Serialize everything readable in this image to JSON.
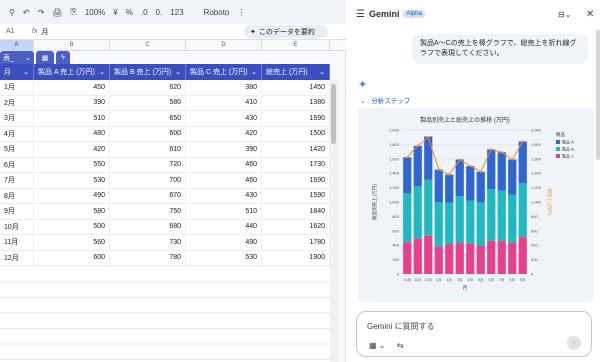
{
  "toolbar": {
    "items": [
      "↶",
      "↷",
      "🖨",
      "⎘",
      "100%",
      "¥",
      "%",
      ".0",
      "0.",
      "123",
      "Roboto",
      "⋮"
    ],
    "summarize_label": "このデータを要約"
  },
  "formula_bar": {
    "cell_ref": "A1",
    "fx": "fx",
    "value": "月"
  },
  "column_letters": [
    "A",
    "B",
    "C",
    "D",
    "E"
  ],
  "table": {
    "name": "表_",
    "headers": [
      "月",
      "製品 A 売上 (万円)",
      "製品 B 売上 (万円)",
      "製品 C 売上 (万円)",
      "総売上 (万円)"
    ],
    "rows": [
      [
        "1月",
        "450",
        "620",
        "380",
        "1450"
      ],
      [
        "2月",
        "390",
        "580",
        "410",
        "1380"
      ],
      [
        "3月",
        "510",
        "650",
        "430",
        "1590"
      ],
      [
        "4月",
        "480",
        "600",
        "420",
        "1500"
      ],
      [
        "5月",
        "420",
        "610",
        "390",
        "1420"
      ],
      [
        "6月",
        "550",
        "720",
        "460",
        "1730"
      ],
      [
        "7月",
        "530",
        "700",
        "460",
        "1690"
      ],
      [
        "8月",
        "490",
        "670",
        "430",
        "1590"
      ],
      [
        "9月",
        "580",
        "750",
        "510",
        "1840"
      ],
      [
        "10月",
        "500",
        "680",
        "440",
        "1620"
      ],
      [
        "11月",
        "560",
        "730",
        "490",
        "1780"
      ],
      [
        "12月",
        "600",
        "780",
        "530",
        "1900"
      ]
    ]
  },
  "gemini": {
    "title": "Gemini",
    "badge": "Alpha",
    "user_message": "製品A〜Cの売上を棒グラフで、総売上を折れ線グラフで表現してください。",
    "steps_label": "分析ステップ",
    "input_placeholder": "Gemini に質問する"
  },
  "chart_data": {
    "type": "bar",
    "title": "製品別売上と総売上の推移 (万円)",
    "xlabel": "月",
    "ylabel": "製品別売上 (万円)",
    "y2label": "総売上 (万円)",
    "categories": [
      "10月",
      "11月",
      "12月",
      "1月",
      "2月",
      "3月",
      "4月",
      "5月",
      "6月",
      "7月",
      "8月",
      "9月"
    ],
    "stacked": true,
    "ylim": [
      0,
      2000
    ],
    "yticks": [
      "0",
      "200",
      "400",
      "600",
      "800",
      "1,000",
      "1,200",
      "1,400",
      "1,600",
      "1,800",
      "2,000"
    ],
    "series": [
      {
        "name": "製品 C",
        "color": "#e8418c",
        "values": [
          440,
          490,
          530,
          380,
          410,
          430,
          420,
          390,
          460,
          460,
          430,
          510
        ]
      },
      {
        "name": "製品 B",
        "color": "#22b8c2",
        "values": [
          680,
          730,
          780,
          620,
          580,
          650,
          600,
          610,
          720,
          700,
          670,
          750
        ]
      },
      {
        "name": "製品 A",
        "color": "#2f66d0",
        "values": [
          500,
          560,
          600,
          450,
          390,
          510,
          480,
          420,
          550,
          530,
          490,
          580
        ]
      }
    ],
    "line": {
      "color": "#f28c28",
      "values": [
        1620,
        1780,
        1900,
        1450,
        1380,
        1590,
        1500,
        1420,
        1730,
        1690,
        1590,
        1840
      ]
    },
    "legend_title": "製品",
    "grid": true,
    "legend_position": "right"
  }
}
